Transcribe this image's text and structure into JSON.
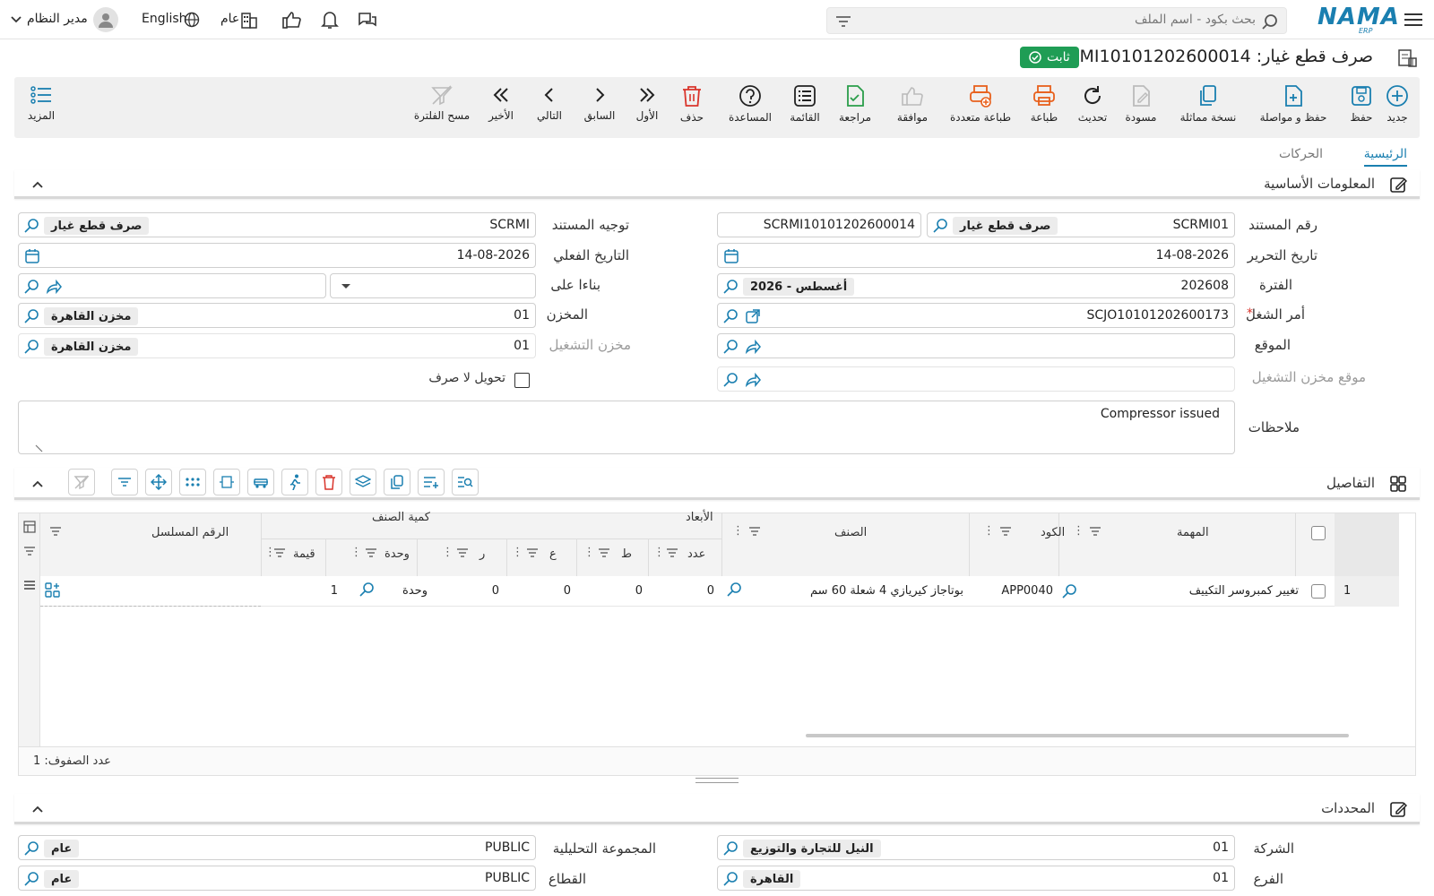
{
  "header": {
    "menu_icon": "hamburger-icon",
    "logo": "NAMA",
    "logo_sub": "ERP",
    "search_placeholder": "بحث بكود - اسم الملف",
    "user_name": "مدير النظام",
    "language": "English",
    "scope": "عام"
  },
  "page": {
    "title": "صرف قطع غيار: SCRMI10101202600014",
    "status": "ثابت"
  },
  "toolbar": {
    "new": "جديد",
    "save": "حفظ",
    "save_continue": "حفظ و مواصلة",
    "duplicate": "نسخة مماثلة",
    "draft": "مسودة",
    "refresh": "تحديث",
    "print": "طباعة",
    "multi_print": "طباعة متعددة",
    "approve": "موافقة",
    "review": "مراجعة",
    "list": "القائمة",
    "help": "المساعدة",
    "delete": "حذف",
    "first": "الأول",
    "previous": "السابق",
    "next": "التالي",
    "last": "الأخير",
    "clear_filter": "مسح الفلترة",
    "more": "المزيد"
  },
  "tabs": {
    "main": "الرئيسية",
    "movements": "الحركات"
  },
  "basic_info": {
    "section_title": "المعلومات الأساسية",
    "doc_no_label": "رقم المستند",
    "doc_no_code": "SCRMI01",
    "doc_no_chip": "صرف قطع غيار",
    "doc_no_value": "SCRMI10101202600014",
    "edit_date_label": "تاريخ التحرير",
    "edit_date": "14-08-2026",
    "period_label": "الفترة",
    "period_code": "202608",
    "period_chip": "2026 - أغسطس",
    "work_order_label": "أمر الشغل",
    "work_order": "SCJO10101202600173",
    "location_label": "الموقع",
    "op_store_location_label": "موقع مخزن التشغيل",
    "doc_direction_label": "توجيه المستند",
    "doc_direction_code": "SCRMI",
    "doc_direction_chip": "صرف قطع غيار",
    "actual_date_label": "التاريخ الفعلي",
    "actual_date": "14-08-2026",
    "based_on_label": "بناءا على",
    "store_label": "المخزن",
    "store_code": "01",
    "store_chip": "مخزن القاهرة",
    "op_store_label": "مخزن التشغيل",
    "op_store_code": "01",
    "op_store_chip": "مخزن القاهرة",
    "transfer_label": "تحويل لا صرف",
    "notes_label": "ملاحظات",
    "notes": "Compressor issued"
  },
  "details": {
    "section_title": "التفاصيل",
    "headers": {
      "task": "المهمة",
      "code": "الكود",
      "item": "الصنف",
      "dimensions": "الأبعاد",
      "qty_group": "كمية الصنف",
      "serial": "الرقم المسلسل",
      "count": "عدد",
      "t": "ط",
      "a": "ع",
      "r": "ر",
      "unit": "وحدة",
      "value": "قيمة"
    },
    "rows": [
      {
        "no": "1",
        "task": "تغيير كمبروسر التكييف",
        "code": "APP0040",
        "item": "بوتاجاز كيريازي 4 شعلة 60 سم",
        "count": "0",
        "t": "0",
        "a": "0",
        "r": "0",
        "unit": "وحدة",
        "value": "1"
      }
    ],
    "row_count": "عدد الصفوف: 1"
  },
  "dimensions_section": {
    "section_title": "المحددات",
    "company_label": "الشركة",
    "company_code": "01",
    "company_chip": "النيل للتجارة والتوزيع",
    "branch_label": "الفرع",
    "branch_code": "01",
    "branch_chip": "القاهرة",
    "analysis_label": "المجموعة التحليلية",
    "analysis_code": "PUBLIC",
    "analysis_chip": "عام",
    "sector_label": "القطاع",
    "sector_code": "PUBLIC",
    "sector_chip": "عام"
  }
}
